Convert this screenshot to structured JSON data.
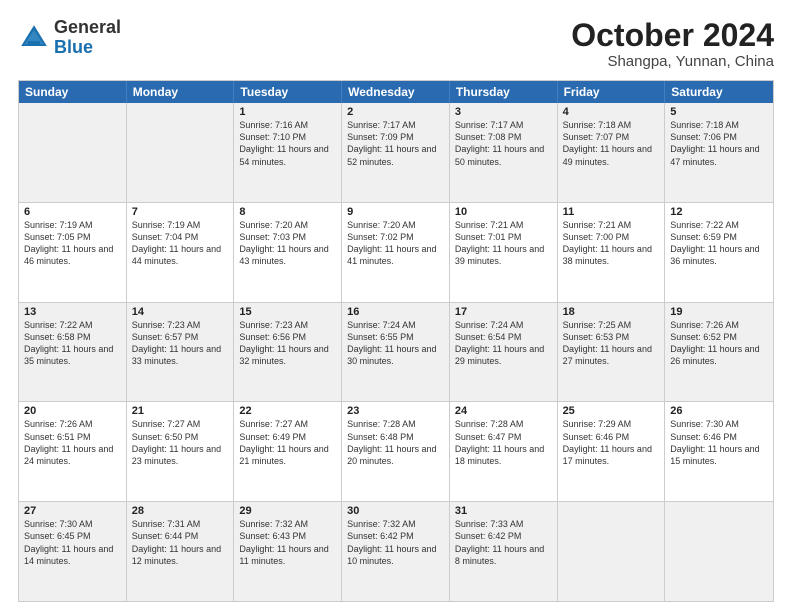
{
  "header": {
    "logo_general": "General",
    "logo_blue": "Blue",
    "month_title": "October 2024",
    "location": "Shangpa, Yunnan, China"
  },
  "weekdays": [
    "Sunday",
    "Monday",
    "Tuesday",
    "Wednesday",
    "Thursday",
    "Friday",
    "Saturday"
  ],
  "rows": [
    [
      {
        "day": "",
        "text": ""
      },
      {
        "day": "",
        "text": ""
      },
      {
        "day": "1",
        "text": "Sunrise: 7:16 AM\nSunset: 7:10 PM\nDaylight: 11 hours and 54 minutes."
      },
      {
        "day": "2",
        "text": "Sunrise: 7:17 AM\nSunset: 7:09 PM\nDaylight: 11 hours and 52 minutes."
      },
      {
        "day": "3",
        "text": "Sunrise: 7:17 AM\nSunset: 7:08 PM\nDaylight: 11 hours and 50 minutes."
      },
      {
        "day": "4",
        "text": "Sunrise: 7:18 AM\nSunset: 7:07 PM\nDaylight: 11 hours and 49 minutes."
      },
      {
        "day": "5",
        "text": "Sunrise: 7:18 AM\nSunset: 7:06 PM\nDaylight: 11 hours and 47 minutes."
      }
    ],
    [
      {
        "day": "6",
        "text": "Sunrise: 7:19 AM\nSunset: 7:05 PM\nDaylight: 11 hours and 46 minutes."
      },
      {
        "day": "7",
        "text": "Sunrise: 7:19 AM\nSunset: 7:04 PM\nDaylight: 11 hours and 44 minutes."
      },
      {
        "day": "8",
        "text": "Sunrise: 7:20 AM\nSunset: 7:03 PM\nDaylight: 11 hours and 43 minutes."
      },
      {
        "day": "9",
        "text": "Sunrise: 7:20 AM\nSunset: 7:02 PM\nDaylight: 11 hours and 41 minutes."
      },
      {
        "day": "10",
        "text": "Sunrise: 7:21 AM\nSunset: 7:01 PM\nDaylight: 11 hours and 39 minutes."
      },
      {
        "day": "11",
        "text": "Sunrise: 7:21 AM\nSunset: 7:00 PM\nDaylight: 11 hours and 38 minutes."
      },
      {
        "day": "12",
        "text": "Sunrise: 7:22 AM\nSunset: 6:59 PM\nDaylight: 11 hours and 36 minutes."
      }
    ],
    [
      {
        "day": "13",
        "text": "Sunrise: 7:22 AM\nSunset: 6:58 PM\nDaylight: 11 hours and 35 minutes."
      },
      {
        "day": "14",
        "text": "Sunrise: 7:23 AM\nSunset: 6:57 PM\nDaylight: 11 hours and 33 minutes."
      },
      {
        "day": "15",
        "text": "Sunrise: 7:23 AM\nSunset: 6:56 PM\nDaylight: 11 hours and 32 minutes."
      },
      {
        "day": "16",
        "text": "Sunrise: 7:24 AM\nSunset: 6:55 PM\nDaylight: 11 hours and 30 minutes."
      },
      {
        "day": "17",
        "text": "Sunrise: 7:24 AM\nSunset: 6:54 PM\nDaylight: 11 hours and 29 minutes."
      },
      {
        "day": "18",
        "text": "Sunrise: 7:25 AM\nSunset: 6:53 PM\nDaylight: 11 hours and 27 minutes."
      },
      {
        "day": "19",
        "text": "Sunrise: 7:26 AM\nSunset: 6:52 PM\nDaylight: 11 hours and 26 minutes."
      }
    ],
    [
      {
        "day": "20",
        "text": "Sunrise: 7:26 AM\nSunset: 6:51 PM\nDaylight: 11 hours and 24 minutes."
      },
      {
        "day": "21",
        "text": "Sunrise: 7:27 AM\nSunset: 6:50 PM\nDaylight: 11 hours and 23 minutes."
      },
      {
        "day": "22",
        "text": "Sunrise: 7:27 AM\nSunset: 6:49 PM\nDaylight: 11 hours and 21 minutes."
      },
      {
        "day": "23",
        "text": "Sunrise: 7:28 AM\nSunset: 6:48 PM\nDaylight: 11 hours and 20 minutes."
      },
      {
        "day": "24",
        "text": "Sunrise: 7:28 AM\nSunset: 6:47 PM\nDaylight: 11 hours and 18 minutes."
      },
      {
        "day": "25",
        "text": "Sunrise: 7:29 AM\nSunset: 6:46 PM\nDaylight: 11 hours and 17 minutes."
      },
      {
        "day": "26",
        "text": "Sunrise: 7:30 AM\nSunset: 6:46 PM\nDaylight: 11 hours and 15 minutes."
      }
    ],
    [
      {
        "day": "27",
        "text": "Sunrise: 7:30 AM\nSunset: 6:45 PM\nDaylight: 11 hours and 14 minutes."
      },
      {
        "day": "28",
        "text": "Sunrise: 7:31 AM\nSunset: 6:44 PM\nDaylight: 11 hours and 12 minutes."
      },
      {
        "day": "29",
        "text": "Sunrise: 7:32 AM\nSunset: 6:43 PM\nDaylight: 11 hours and 11 minutes."
      },
      {
        "day": "30",
        "text": "Sunrise: 7:32 AM\nSunset: 6:42 PM\nDaylight: 11 hours and 10 minutes."
      },
      {
        "day": "31",
        "text": "Sunrise: 7:33 AM\nSunset: 6:42 PM\nDaylight: 11 hours and 8 minutes."
      },
      {
        "day": "",
        "text": ""
      },
      {
        "day": "",
        "text": ""
      }
    ]
  ]
}
